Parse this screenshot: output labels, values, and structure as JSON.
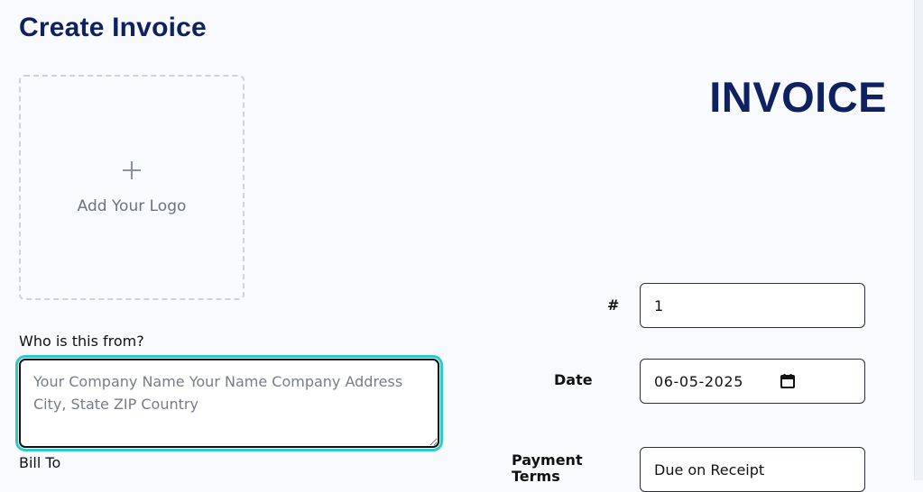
{
  "page": {
    "title": "Create Invoice"
  },
  "logo_upload": {
    "icon": "plus-icon",
    "label": "Add Your Logo"
  },
  "invoice": {
    "heading": "INVOICE"
  },
  "from": {
    "label": "Who is this from?",
    "placeholder": "Your Company Name Your Name Company Address City, State ZIP Country",
    "value": ""
  },
  "bill_to": {
    "label": "Bill To"
  },
  "meta": {
    "number_label": "#",
    "number_value": "1",
    "date_label": "Date",
    "date_value": "06-05-2025",
    "date_icon": "calendar-icon",
    "terms_label": "Payment Terms",
    "terms_value": "Due on Receipt"
  },
  "colors": {
    "title": "#0f2160",
    "focus_ring": "#2ec9cf",
    "background": "#f8fafd"
  }
}
